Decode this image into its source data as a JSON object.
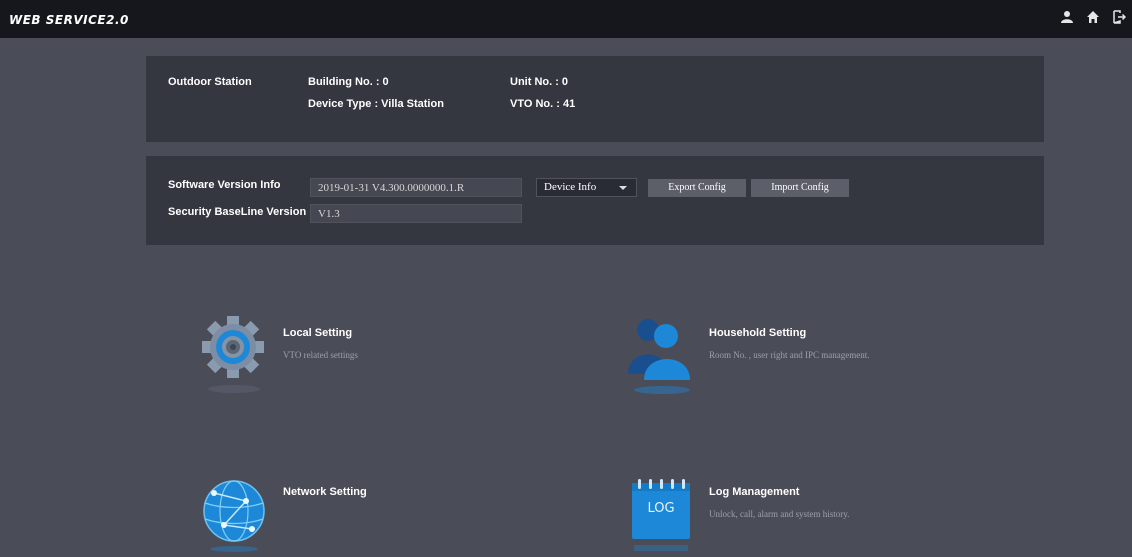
{
  "header": {
    "brand": "WEB SERVICE2.0",
    "icons": [
      "user-icon",
      "home-icon",
      "logout-icon"
    ]
  },
  "device": {
    "outdoor_station_label": "Outdoor Station",
    "building_no": "Building No. : 0",
    "device_type": "Device Type : Villa Station",
    "unit_no": "Unit No. : 0",
    "vto_no": "VTO No. : 41"
  },
  "version": {
    "software_label": "Software Version Info",
    "software_value": "2019-01-31 V4.300.0000000.1.R",
    "baseline_label": "Security BaseLine Version",
    "baseline_value": "V1.3",
    "info_select": "Device Info",
    "export_label": "Export Config",
    "import_label": "Import Config"
  },
  "menu": {
    "local": {
      "title": "Local Setting",
      "desc": "VTO related settings",
      "icon": "gear-icon"
    },
    "household": {
      "title": "Household Setting",
      "desc": "Room No. , user right and IPC management.",
      "icon": "users-icon"
    },
    "network": {
      "title": "Network Setting",
      "desc": "",
      "icon": "globe-icon"
    },
    "log": {
      "title": "Log Management",
      "desc": "Unlock, call, alarm and system history.",
      "icon": "log-icon",
      "icon_text": "LOG"
    }
  },
  "colors": {
    "background": "#4a4c57",
    "topbar": "#16171c",
    "panel": "#343640",
    "accent_blue": "#1e88d8"
  }
}
